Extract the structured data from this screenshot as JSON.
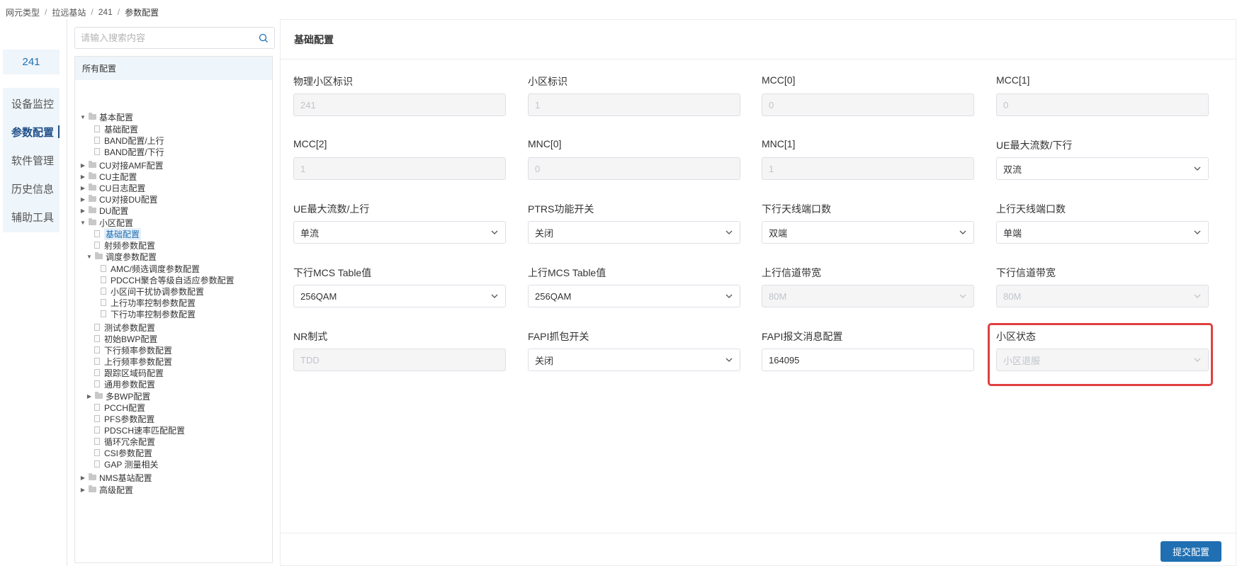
{
  "breadcrumb": [
    "网元类型",
    "拉远基站",
    "241",
    "参数配置"
  ],
  "device_name": "241",
  "nav": [
    "设备监控",
    "参数配置",
    "软件管理",
    "历史信息",
    "辅助工具"
  ],
  "nav_active": 1,
  "search": {
    "placeholder": "请输入搜索内容"
  },
  "tree": {
    "header": "所有配置",
    "nodes": [
      {
        "label": "基本配置",
        "type": "folder",
        "expanded": true,
        "level": 0
      },
      {
        "label": "基础配置",
        "type": "doc",
        "level": 1
      },
      {
        "label": "BAND配置/上行",
        "type": "doc",
        "level": 1
      },
      {
        "label": "BAND配置/下行",
        "type": "doc",
        "level": 1
      },
      {
        "label": "CU对接AMF配置",
        "type": "folder",
        "expanded": false,
        "level": 0
      },
      {
        "label": "CU主配置",
        "type": "folder",
        "expanded": false,
        "level": 0
      },
      {
        "label": "CU日志配置",
        "type": "folder",
        "expanded": false,
        "level": 0
      },
      {
        "label": "CU对接DU配置",
        "type": "folder",
        "expanded": false,
        "level": 0
      },
      {
        "label": "DU配置",
        "type": "folder",
        "expanded": false,
        "level": 0
      },
      {
        "label": "小区配置",
        "type": "folder",
        "expanded": true,
        "level": 0
      },
      {
        "label": "基础配置",
        "type": "doc",
        "level": 1,
        "selected": true
      },
      {
        "label": "射频参数配置",
        "type": "doc",
        "level": 1
      },
      {
        "label": "调度参数配置",
        "type": "folder",
        "expanded": true,
        "level": 1
      },
      {
        "label": "AMC/频选调度参数配置",
        "type": "doc",
        "level": 2
      },
      {
        "label": "PDCCH聚合等级自适应参数配置",
        "type": "doc",
        "level": 2
      },
      {
        "label": "小区间干扰协调参数配置",
        "type": "doc",
        "level": 2
      },
      {
        "label": "上行功率控制参数配置",
        "type": "doc",
        "level": 2
      },
      {
        "label": "下行功率控制参数配置",
        "type": "doc",
        "level": 2
      },
      {
        "label": "测试参数配置",
        "type": "doc",
        "level": 1
      },
      {
        "label": "初始BWP配置",
        "type": "doc",
        "level": 1
      },
      {
        "label": "下行频率参数配置",
        "type": "doc",
        "level": 1
      },
      {
        "label": "上行频率参数配置",
        "type": "doc",
        "level": 1
      },
      {
        "label": "跟踪区域码配置",
        "type": "doc",
        "level": 1
      },
      {
        "label": "通用参数配置",
        "type": "doc",
        "level": 1
      },
      {
        "label": "多BWP配置",
        "type": "folder",
        "expanded": false,
        "level": 1
      },
      {
        "label": "PCCH配置",
        "type": "doc",
        "level": 1
      },
      {
        "label": "PFS参数配置",
        "type": "doc",
        "level": 1
      },
      {
        "label": "PDSCH速率匹配配置",
        "type": "doc",
        "level": 1
      },
      {
        "label": "循环冗余配置",
        "type": "doc",
        "level": 1
      },
      {
        "label": "CSI参数配置",
        "type": "doc",
        "level": 1
      },
      {
        "label": "GAP 测量相关",
        "type": "doc",
        "level": 1
      },
      {
        "label": "NMS基站配置",
        "type": "folder",
        "expanded": false,
        "level": 0
      },
      {
        "label": "高级配置",
        "type": "folder",
        "expanded": false,
        "level": 0
      }
    ]
  },
  "main": {
    "title": "基础配置",
    "fields": [
      {
        "label": "物理小区标识",
        "value": "241",
        "kind": "text",
        "disabled": true
      },
      {
        "label": "小区标识",
        "value": "1",
        "kind": "text",
        "disabled": true
      },
      {
        "label": "MCC[0]",
        "value": "0",
        "kind": "text",
        "disabled": true
      },
      {
        "label": "MCC[1]",
        "value": "0",
        "kind": "text",
        "disabled": true
      },
      {
        "label": "MCC[2]",
        "value": "1",
        "kind": "text",
        "disabled": true
      },
      {
        "label": "MNC[0]",
        "value": "0",
        "kind": "text",
        "disabled": true
      },
      {
        "label": "MNC[1]",
        "value": "1",
        "kind": "text",
        "disabled": true
      },
      {
        "label": "UE最大流数/下行",
        "value": "双流",
        "kind": "select",
        "disabled": false
      },
      {
        "label": "UE最大流数/上行",
        "value": "单流",
        "kind": "select",
        "disabled": false
      },
      {
        "label": "PTRS功能开关",
        "value": "关闭",
        "kind": "select",
        "disabled": false
      },
      {
        "label": "下行天线端口数",
        "value": "双端",
        "kind": "select",
        "disabled": false
      },
      {
        "label": "上行天线端口数",
        "value": "单端",
        "kind": "select",
        "disabled": false
      },
      {
        "label": "下行MCS Table值",
        "value": "256QAM",
        "kind": "select",
        "disabled": false
      },
      {
        "label": "上行MCS Table值",
        "value": "256QAM",
        "kind": "select",
        "disabled": false
      },
      {
        "label": "上行信道带宽",
        "value": "80M",
        "kind": "select",
        "disabled": true
      },
      {
        "label": "下行信道带宽",
        "value": "80M",
        "kind": "select",
        "disabled": true
      },
      {
        "label": "NR制式",
        "value": "TDD",
        "kind": "text",
        "disabled": true
      },
      {
        "label": "FAPI抓包开关",
        "value": "关闭",
        "kind": "select",
        "disabled": false
      },
      {
        "label": "FAPI报文消息配置",
        "value": "164095",
        "kind": "input",
        "disabled": false
      },
      {
        "label": "小区状态",
        "value": "小区退服",
        "kind": "select",
        "disabled": true
      }
    ],
    "submit_label": "提交配置"
  },
  "colors": {
    "accent": "#1f6fb2",
    "highlight": "#e04040",
    "nav_bg": "#eef5fb"
  }
}
